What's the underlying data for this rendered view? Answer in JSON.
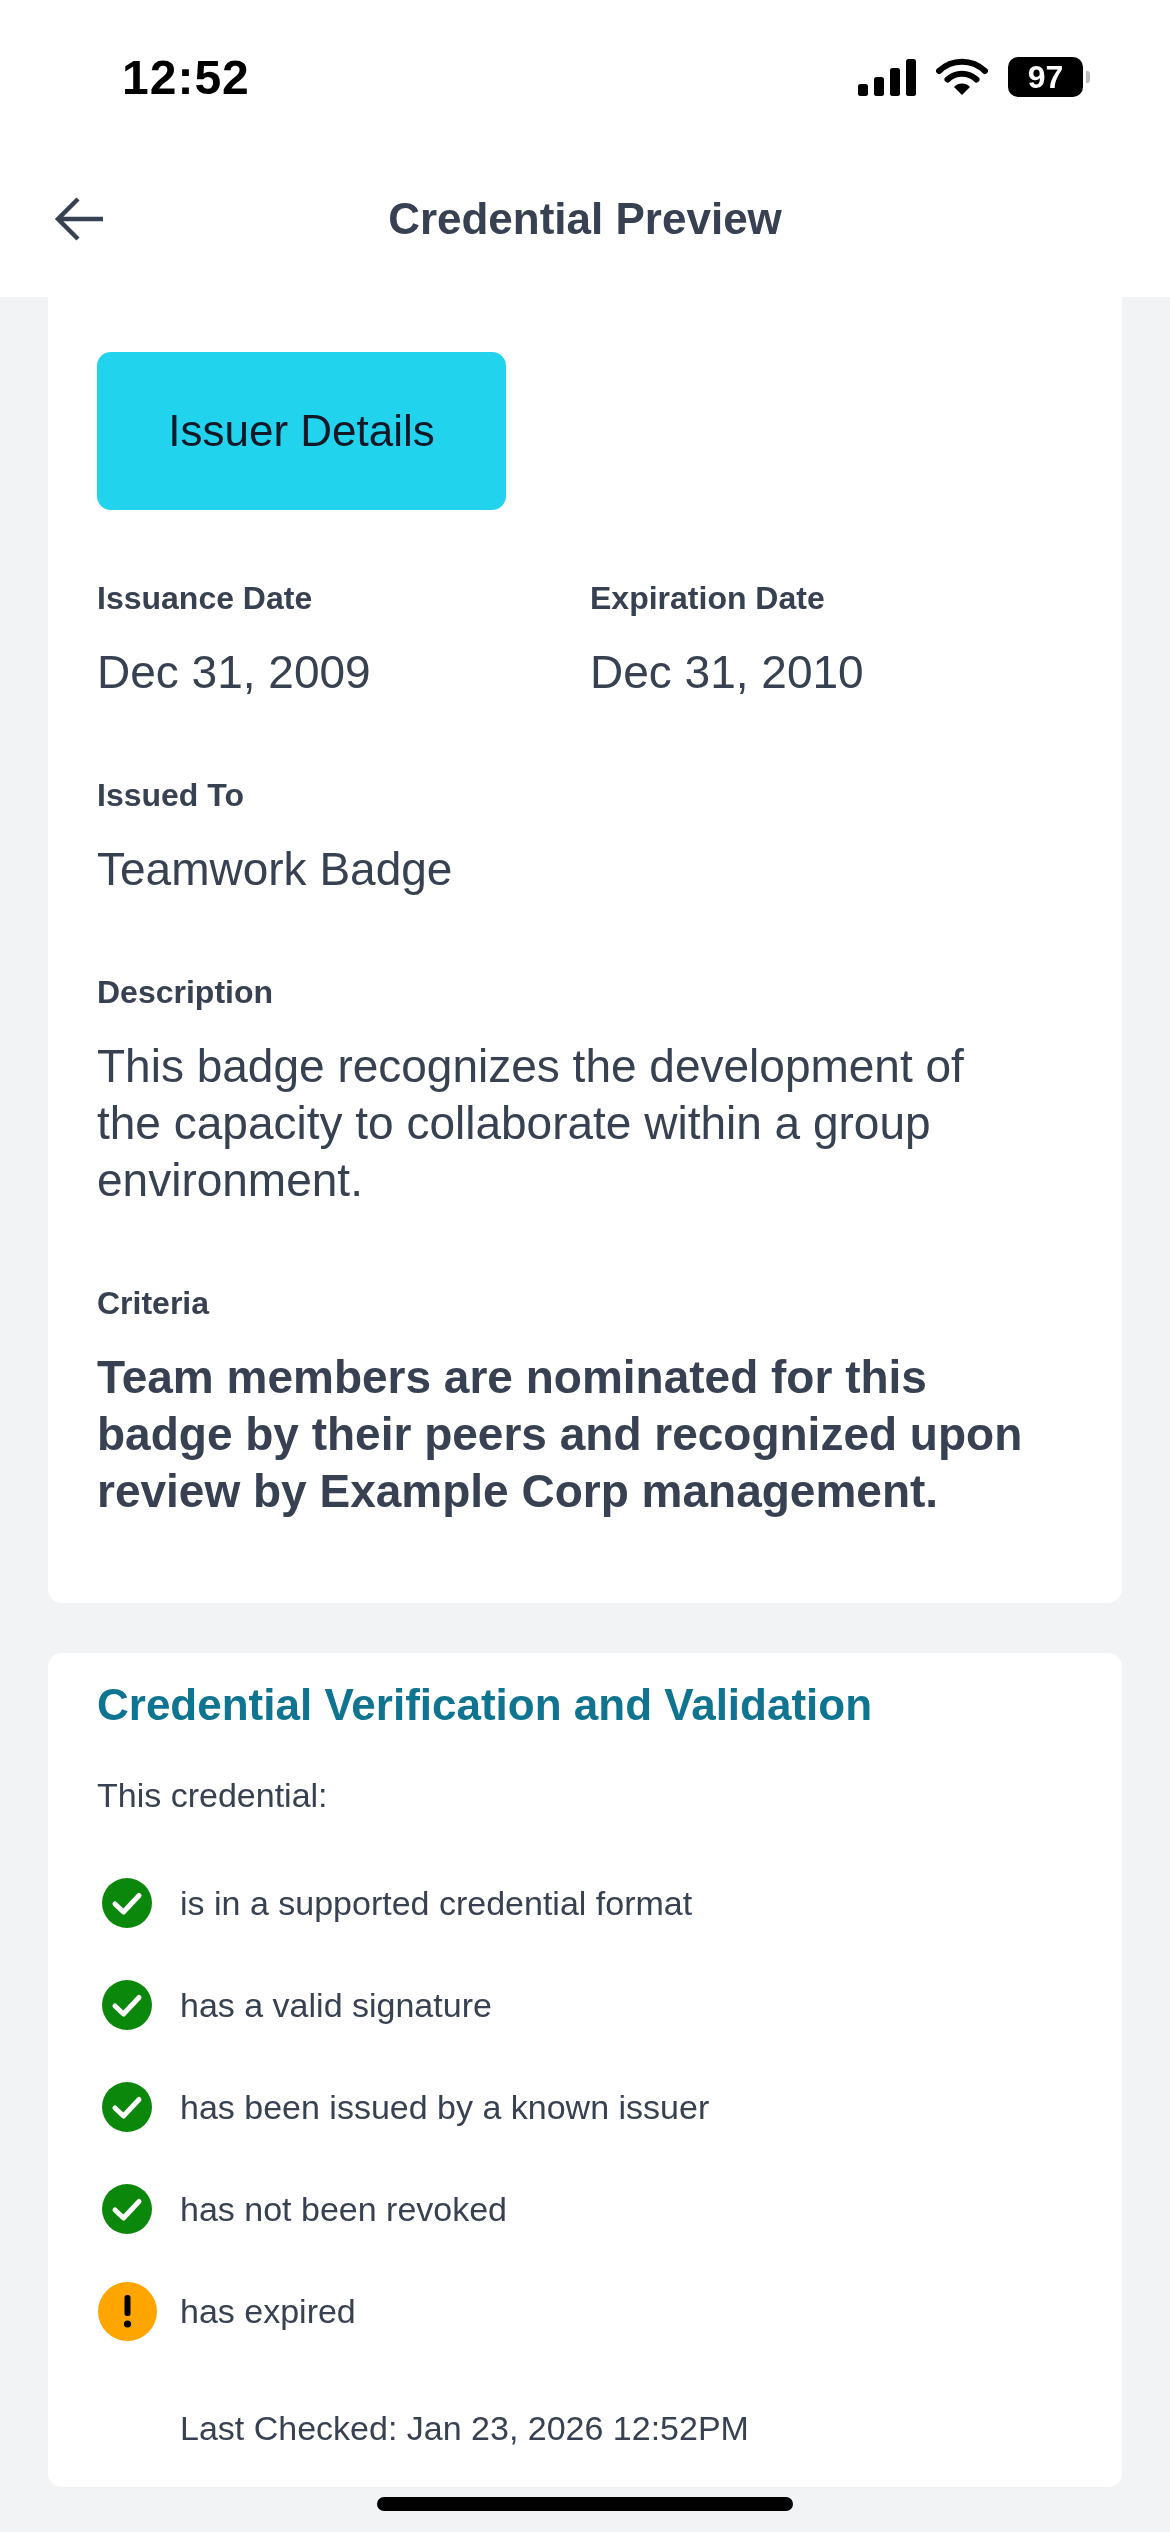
{
  "status_bar": {
    "time": "12:52",
    "battery": "97"
  },
  "header": {
    "title": "Credential Preview"
  },
  "details": {
    "issuer_button": "Issuer Details",
    "dates": [
      {
        "label": "Issuance Date",
        "value": "Dec 31, 2009"
      },
      {
        "label": "Expiration Date",
        "value": "Dec 31, 2010"
      }
    ],
    "fields": [
      {
        "label": "Issued To",
        "value": "Teamwork Badge",
        "kind": "text"
      },
      {
        "label": "Description",
        "value": "This badge recognizes the development of the capacity to collaborate within a group environment.",
        "kind": "text"
      },
      {
        "label": "Criteria",
        "value": "Team members are nominated for this badge by their peers and recognized upon review by Example Corp management.",
        "kind": "strong"
      }
    ]
  },
  "verification": {
    "title": "Credential Verification and Validation",
    "intro": "This credential:",
    "checks": [
      {
        "text": "is in a supported credential format",
        "kind": "passed"
      },
      {
        "text": "has a valid signature",
        "kind": "passed"
      },
      {
        "text": "has been issued by a known issuer",
        "kind": "passed"
      },
      {
        "text": "has not been revoked",
        "kind": "passed"
      },
      {
        "text": "has expired",
        "kind": "warning"
      }
    ],
    "last_checked": "Last Checked: Jan 23, 2026 12:52PM"
  }
}
